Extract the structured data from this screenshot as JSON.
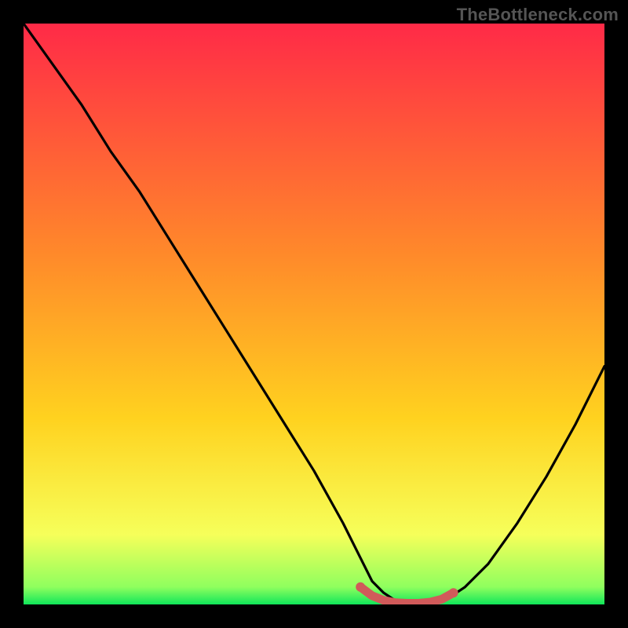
{
  "watermark": "TheBottleneck.com",
  "chart_data": {
    "type": "line",
    "title": "",
    "xlabel": "",
    "ylabel": "",
    "xlim": [
      0,
      100
    ],
    "ylim": [
      0,
      100
    ],
    "grid": false,
    "background_gradient": {
      "top_color": "#ff2a47",
      "mid_color": "#ffd21f",
      "bottom_color": "#10e65a"
    },
    "series": [
      {
        "name": "bottleneck-curve",
        "color": "#000000",
        "x": [
          0,
          5,
          10,
          15,
          20,
          25,
          30,
          35,
          40,
          45,
          50,
          55,
          58,
          60,
          62,
          65,
          68,
          70,
          73,
          76,
          80,
          85,
          90,
          95,
          100
        ],
        "values": [
          100,
          93,
          86,
          78,
          71,
          63,
          55,
          47,
          39,
          31,
          23,
          14,
          8,
          4,
          2,
          0,
          0,
          0,
          1,
          3,
          7,
          14,
          22,
          31,
          41
        ]
      },
      {
        "name": "optimal-segment",
        "type": "line",
        "color": "#d15a5a",
        "linewidth": 6,
        "x": [
          58,
          60,
          62,
          64,
          66,
          68,
          70,
          72,
          74
        ],
        "values": [
          3,
          1.5,
          0.7,
          0.3,
          0.2,
          0.2,
          0.4,
          0.9,
          2
        ]
      }
    ],
    "markers": [
      {
        "name": "optimal-start",
        "x": 58,
        "y": 3,
        "color": "#d15a5a",
        "r": 6
      },
      {
        "name": "optimal-end",
        "x": 74,
        "y": 2,
        "color": "#d15a5a",
        "r": 6
      }
    ]
  }
}
